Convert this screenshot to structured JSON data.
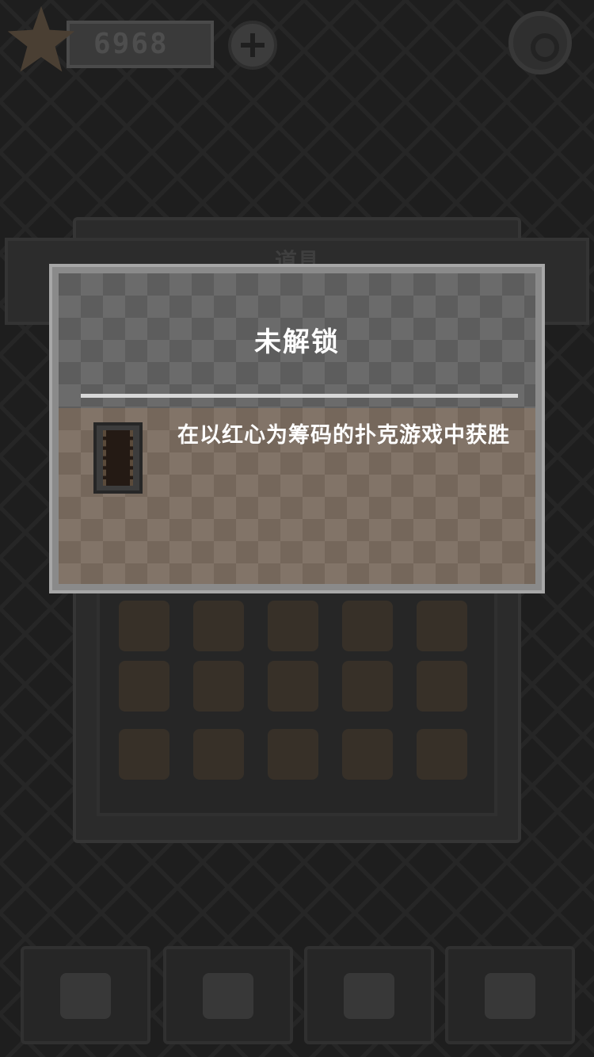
{
  "topbar": {
    "coins": "6968"
  },
  "panel": {
    "title": "道具"
  },
  "modal": {
    "title": "未解锁",
    "item_icon": "film-strip-icon",
    "description": "在以红心为筹码的扑克游戏中获胜"
  },
  "colors": {
    "modal_border": "#a7a7a7",
    "modal_header": "#5d5d5d",
    "modal_body": "#75675b",
    "divider": "#d8d8d8"
  }
}
